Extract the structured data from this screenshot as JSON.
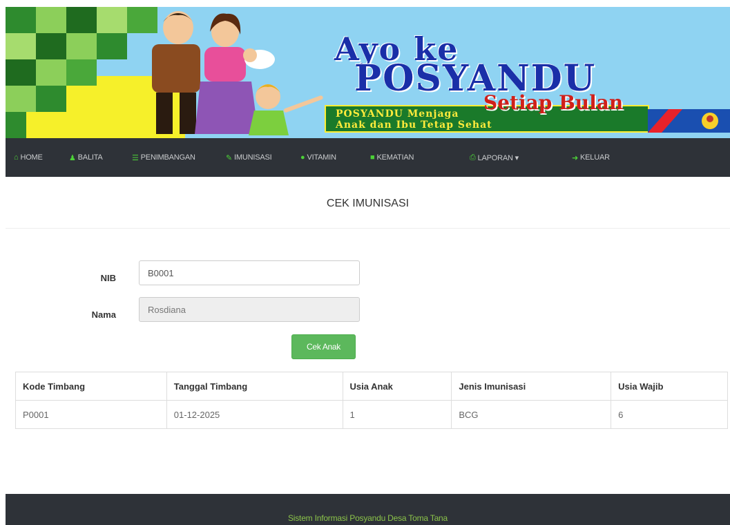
{
  "banner": {
    "title_line1": "Ayo ke",
    "title_line2": "POSYANDU",
    "title_line3": "Setiap Bulan",
    "slogan_line1": "POSYANDU Menjaga",
    "slogan_line2": "Anak dan Ibu Tetap Sehat"
  },
  "nav": {
    "items": [
      {
        "icon": "home-icon",
        "glyph": "⌂",
        "label": "HOME"
      },
      {
        "icon": "user-icon",
        "glyph": "♟",
        "label": "BALITA"
      },
      {
        "icon": "list-icon",
        "glyph": "☰",
        "label": "PENIMBANGAN"
      },
      {
        "icon": "syringe-icon",
        "glyph": "✎",
        "label": "IMUNISASI"
      },
      {
        "icon": "drop-icon",
        "glyph": "●",
        "label": "VITAMIN"
      },
      {
        "icon": "file-icon",
        "glyph": "■",
        "label": "KEMATIAN"
      },
      {
        "icon": "print-icon",
        "glyph": "⎙",
        "label": "LAPORAN ▾"
      },
      {
        "icon": "logout-icon",
        "glyph": "➜",
        "label": "KELUAR"
      }
    ]
  },
  "page": {
    "title": "CEK IMUNISASI"
  },
  "form": {
    "nib_label": "NIB",
    "nib_value": "B0001",
    "nama_label": "Nama",
    "nama_value": "Rosdiana",
    "button_label": "Cek Anak"
  },
  "table": {
    "headers": [
      "Kode Timbang",
      "Tanggal Timbang",
      "Usia Anak",
      "Jenis Imunisasi",
      "Usia Wajib"
    ],
    "rows": [
      [
        "P0001",
        "01-12-2025",
        "1",
        "BCG",
        "6"
      ]
    ]
  },
  "footer": {
    "text": "Sistem Informasi Posyandu Desa Toma Tana"
  },
  "colors": {
    "navbar": "#2e3238",
    "button": "#5cb85c",
    "footer_text": "#8bc34a",
    "banner_sky": "#8fd3f2"
  }
}
